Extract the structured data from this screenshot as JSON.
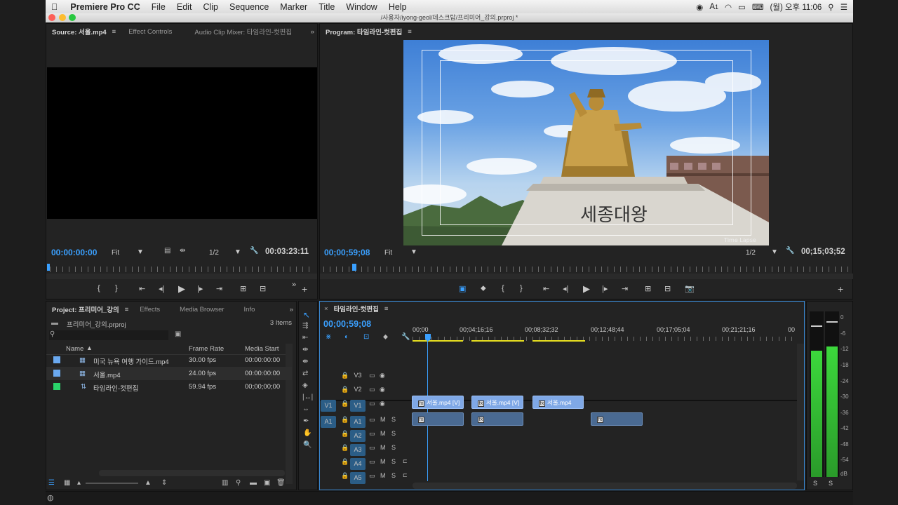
{
  "menubar": {
    "app_name": "Premiere Pro CC",
    "items": [
      "File",
      "Edit",
      "Clip",
      "Sequence",
      "Marker",
      "Title",
      "Window",
      "Help"
    ],
    "status": {
      "input_icon": "A",
      "battery_indicator": "1",
      "clock": "(월) 오후 11:06"
    }
  },
  "window": {
    "title": "/사용자/iyong-geol/데스크탑/프리미어_강의.prproj *"
  },
  "source_panel": {
    "tabs": [
      "Source: 서울.mp4",
      "Effect Controls",
      "Audio Clip Mixer: 타임라인-컷편집"
    ],
    "timecode": "00:00:00:00",
    "zoom": "Fit",
    "resolution": "1/2",
    "duration": "00:03:23:11"
  },
  "program_panel": {
    "title": "Program: 타임라인-컷편집",
    "timecode": "00;00;59;08",
    "zoom": "Fit",
    "resolution": "1/2",
    "duration": "00;15;03;52",
    "video": {
      "sign_text": "세종대왕",
      "watermark": "Time Lapse"
    }
  },
  "project_panel": {
    "tabs": [
      "Project: 프리미어_강의",
      "Effects",
      "Media Browser",
      "Info"
    ],
    "project_file": "프리미어_강의.prproj",
    "item_count": "3 Items",
    "columns": {
      "name": "Name",
      "frame_rate": "Frame Rate",
      "media_start": "Media Start"
    },
    "items": [
      {
        "name": "미국 뉴욕 여행 가이드.mp4",
        "frame_rate": "30.00 fps",
        "media_start": "00:00:00:00",
        "color": "#6aa9f0"
      },
      {
        "name": "서울.mp4",
        "frame_rate": "24.00 fps",
        "media_start": "00:00:00:00",
        "color": "#6aa9f0"
      },
      {
        "name": "타임라인-컷편집",
        "frame_rate": "59.94 fps",
        "media_start": "00;00;00;00",
        "color": "#2ad36b"
      }
    ]
  },
  "timeline": {
    "tab": "타임라인-컷편집",
    "timecode": "00;00;59;08",
    "ruler": [
      "00;00",
      "00;04;16;16",
      "00;08;32;32",
      "00;12;48;44",
      "00;17;05;04",
      "00;21;21;16",
      "00"
    ],
    "video_tracks": [
      "V3",
      "V2",
      "V1"
    ],
    "audio_tracks": [
      "A1",
      "A2",
      "A3",
      "A4",
      "A5"
    ],
    "track_labels": {
      "mute": "M",
      "solo": "S"
    },
    "v1_source": "V1",
    "a1_source": "A1",
    "video_clips": [
      "서울.mp4 [V]",
      "서울.mp4 [V]",
      "서울.mp4"
    ]
  },
  "meters": {
    "scale": [
      "0",
      "-6",
      "-12",
      "-18",
      "-24",
      "-30",
      "-36",
      "-42",
      "-48",
      "-54",
      "dB"
    ],
    "footer": [
      "S",
      "S"
    ]
  }
}
